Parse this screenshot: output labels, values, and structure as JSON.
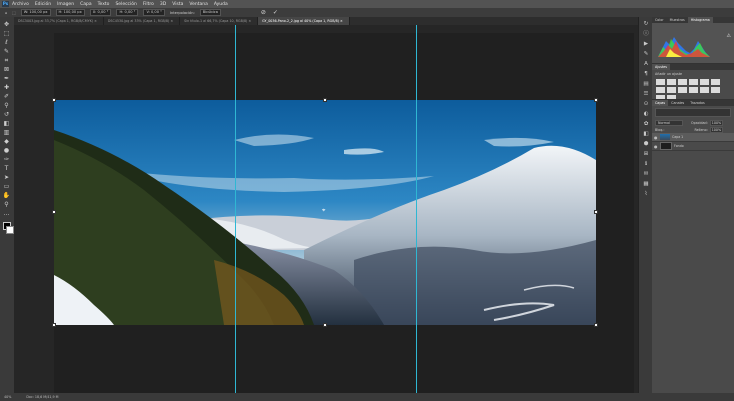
{
  "menubar": {
    "app_icon": "Ps",
    "items": [
      "Archivo",
      "Edición",
      "Imagen",
      "Capa",
      "Texto",
      "Selección",
      "Filtro",
      "3D",
      "Vista",
      "Ventana",
      "Ayuda"
    ]
  },
  "optbar": {
    "fields": [
      "W: 100,00 px",
      "H: 100,00 px",
      "X: 0,00 °",
      "H: 0,00 °",
      "V: 0,00 °"
    ],
    "interp_label": "Interpolación:",
    "interp_value": "Bicúbica",
    "cancel_icon": "cancel-icon",
    "commit_icon": "check-icon"
  },
  "tabs": [
    {
      "label": "DSC5003.jpg al 33,7% (Capa 1, RGB/8/CMYK) ×",
      "active": false
    },
    {
      "label": "DSC4530.jpg al 33% (Capa 1, RGB/8) ×",
      "active": false
    },
    {
      "label": "Sin título-1 al 66,7% (Capa 10, RGB/8) ×",
      "active": false
    },
    {
      "label": "GY_0036-Pano-2_2.jpg al 40% (Capa 1, RGB/8) ×",
      "active": true
    }
  ],
  "status": {
    "zoom": "40%",
    "doc": "Doc: 18,6 M/41,9 M"
  },
  "panels": {
    "top_tabs": [
      "Color",
      "Muestras",
      "Histograma"
    ],
    "adjust_tabs": [
      "Ajustes"
    ],
    "adjust_hint": "Añadir un ajuste",
    "layer_tabs": [
      "Capas",
      "Canales",
      "Trazados"
    ],
    "blend_mode": "Normal",
    "opacity_label": "Opacidad:",
    "opacity_value": "100%",
    "fill_label": "Relleno:",
    "fill_value": "100%",
    "lock_label": "Bloq.:",
    "layers": [
      {
        "name": "Capa 1",
        "selected": true
      },
      {
        "name": "Fondo",
        "selected": false
      }
    ]
  },
  "colors": {
    "guide": "#2fb7d3",
    "accent": "#4fb0ff"
  }
}
